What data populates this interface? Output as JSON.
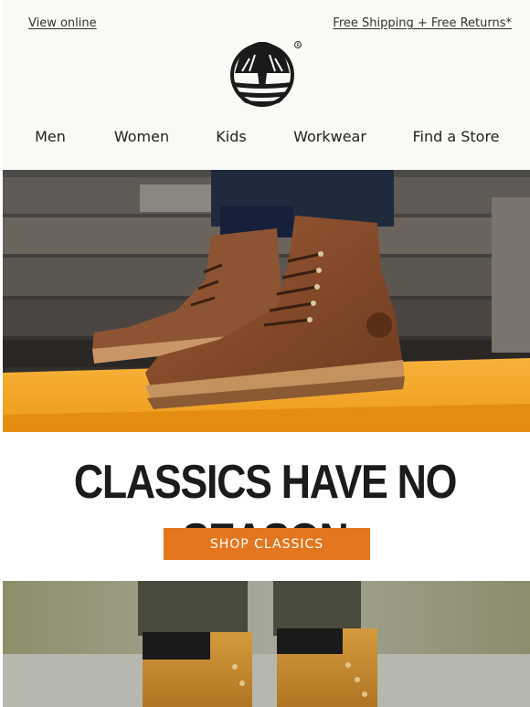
{
  "header": {
    "view_online": "View online",
    "shipping": "Free Shipping + Free Returns*"
  },
  "nav": {
    "items": [
      {
        "label": "Men"
      },
      {
        "label": "Women"
      },
      {
        "label": "Kids"
      },
      {
        "label": "Workwear"
      },
      {
        "label": "Find a Store"
      }
    ]
  },
  "main": {
    "headline": "CLASSICS HAVE NO SEASON",
    "cta_label": "SHOP CLASSICS"
  },
  "colors": {
    "accent": "#e3761e",
    "header_bg": "#f9f9f6",
    "text_dark": "#1b1b1b"
  },
  "icons": {
    "logo": "timberland-tree-logo"
  }
}
